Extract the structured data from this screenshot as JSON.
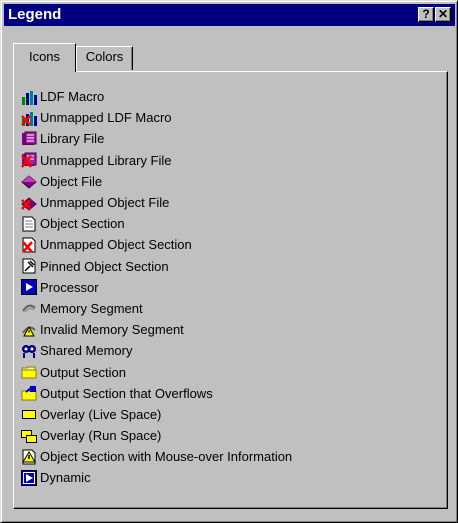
{
  "window": {
    "title": "Legend",
    "help_label": "?",
    "close_label": "✕"
  },
  "tabs": [
    {
      "label": "Icons",
      "active": true
    },
    {
      "label": "Colors",
      "active": false
    }
  ],
  "legend_items": [
    {
      "label": "LDF Macro",
      "icon": "ldf-macro-icon"
    },
    {
      "label": "Unmapped LDF Macro",
      "icon": "unmapped-ldf-macro-icon"
    },
    {
      "label": "Library File",
      "icon": "library-file-icon"
    },
    {
      "label": "Unmapped Library File",
      "icon": "unmapped-library-file-icon"
    },
    {
      "label": "Object File",
      "icon": "object-file-icon"
    },
    {
      "label": "Unmapped Object File",
      "icon": "unmapped-object-file-icon"
    },
    {
      "label": "Object Section",
      "icon": "object-section-icon"
    },
    {
      "label": "Unmapped Object Section",
      "icon": "unmapped-object-section-icon"
    },
    {
      "label": "Pinned Object Section",
      "icon": "pinned-object-section-icon"
    },
    {
      "label": "Processor",
      "icon": "processor-icon"
    },
    {
      "label": "Memory Segment",
      "icon": "memory-segment-icon"
    },
    {
      "label": "Invalid Memory Segment",
      "icon": "invalid-memory-segment-icon"
    },
    {
      "label": "Shared Memory",
      "icon": "shared-memory-icon"
    },
    {
      "label": "Output Section",
      "icon": "output-section-icon"
    },
    {
      "label": "Output Section that Overflows",
      "icon": "output-section-overflow-icon"
    },
    {
      "label": "Overlay (Live Space)",
      "icon": "overlay-live-space-icon"
    },
    {
      "label": "Overlay (Run Space)",
      "icon": "overlay-run-space-icon"
    },
    {
      "label": "Object Section with Mouse-over Information",
      "icon": "object-section-mouseover-icon"
    },
    {
      "label": "Dynamic",
      "icon": "dynamic-icon"
    }
  ],
  "colors": {
    "titlebar": "#000080",
    "face": "#c0c0c0"
  }
}
